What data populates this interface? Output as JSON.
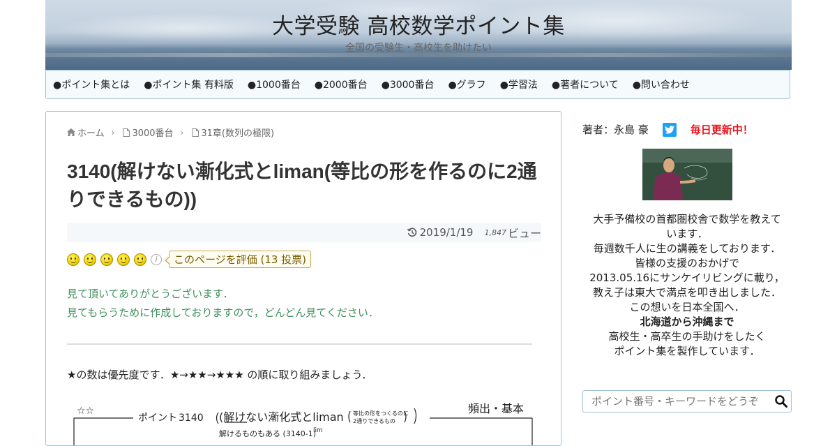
{
  "header": {
    "title": "大学受験 高校数学ポイント集",
    "subtitle": "全国の受験生・高校生を助けたい"
  },
  "nav": {
    "items": [
      {
        "label": "●ポイント集とは"
      },
      {
        "label": "●ポイント集 有料版"
      },
      {
        "label": "●1000番台"
      },
      {
        "label": "●2000番台"
      },
      {
        "label": "●3000番台"
      },
      {
        "label": "●グラフ"
      },
      {
        "label": "●学習法"
      },
      {
        "label": "●著者について"
      },
      {
        "label": "●問い合わせ"
      }
    ]
  },
  "breadcrumb": {
    "home": "ホーム",
    "level1": "3000番台",
    "level2": "31章(数列の極限)"
  },
  "post": {
    "title": "3140(解けない漸化式とliman(等比の形を作るのに2通りできるもの))",
    "date": "2019/1/19",
    "views_count": "1,847",
    "views_label": "ビュー",
    "rating_label": "このページを評価 (13 投票)",
    "thanks_line1": "見て頂いてありがとうございます．",
    "thanks_line2": "見てもらうために作成しておりますので，どんどん見てください．",
    "priority_note": "★の数は優先度です．★→★★→★★★ の順に取り組みましょう．",
    "handwriting": {
      "stars": "☆☆",
      "point_label": "ポイント",
      "point_number": "3140",
      "heading": "(解けない漸化式とliman",
      "heading_note_1": "等比の形をつくるのに",
      "heading_note_2": "2通りできるもの",
      "frequency": "頻出・基本",
      "solvable_note": "解けるものもある (3140-1)",
      "lim_note": "lim"
    }
  },
  "sidebar": {
    "author": "著者：永島 豪",
    "update_badge": "毎日更新中！",
    "bio_lines": [
      "大手予備校の首都圏校舎で数学を教えて",
      "います．",
      "毎週数千人に生の講義をしております．",
      "皆様の支援のおかげで",
      "2013.05.16にサンケイリビングに載り，",
      "教え子は東大で満点を叩き出しました．",
      "この想いを日本全国へ．"
    ],
    "bio_bold": "北海道から沖縄まで",
    "bio_tail": [
      "高校生・高卒生の手助けをしたく",
      "ポイント集を製作しています．"
    ],
    "search_placeholder": "ポイント番号・キーワードをどうぞ"
  },
  "colors": {
    "accent_border": "#9cc3d3",
    "thanks_green": "#3f8f5e",
    "update_red": "#e6141a",
    "twitter_blue": "#1da1f2"
  }
}
